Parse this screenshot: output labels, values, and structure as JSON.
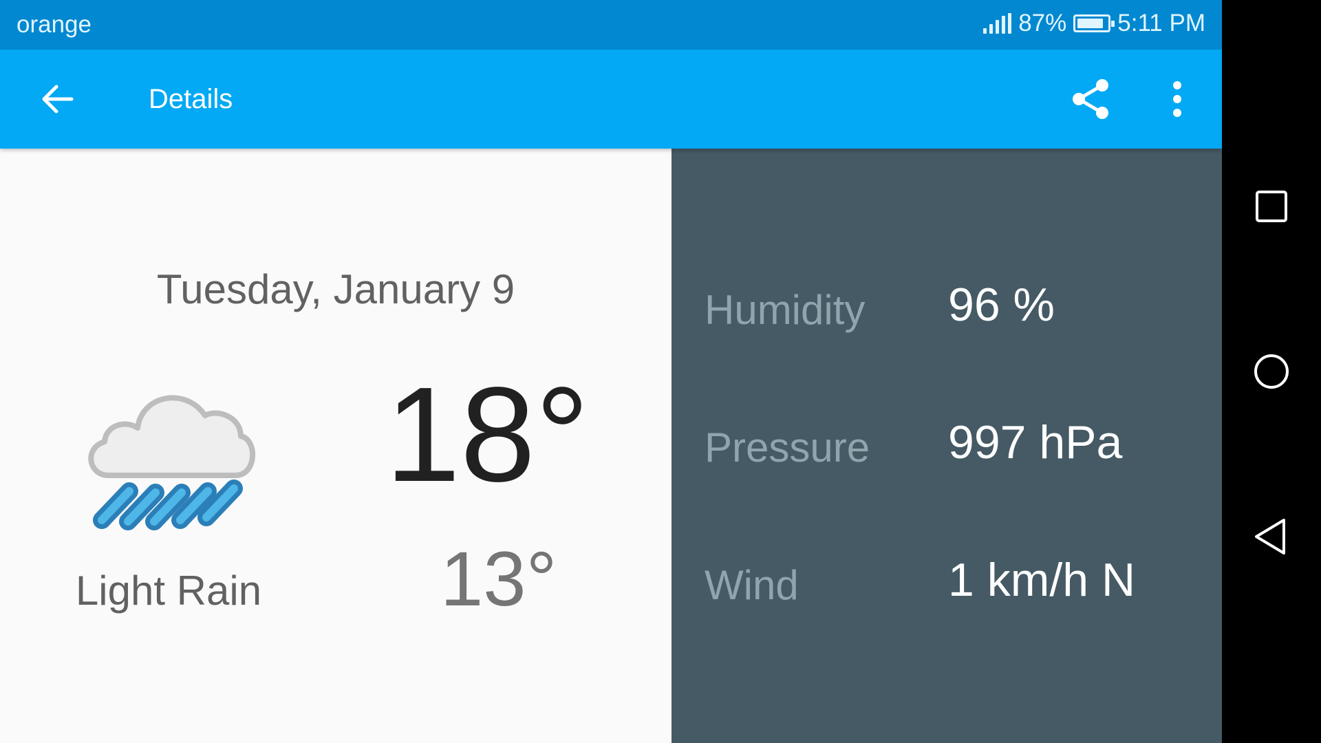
{
  "status_bar": {
    "carrier": "orange",
    "battery": "87%",
    "battery_level": 0.87,
    "time": "5:11 PM",
    "icons": [
      "signal-icon",
      "battery-icon"
    ]
  },
  "app_bar": {
    "title": "Details",
    "icons": [
      "back-arrow-icon",
      "share-icon",
      "more-vert-icon"
    ],
    "color": "#03a9f4"
  },
  "forecast": {
    "date": "Tuesday, January 9",
    "condition": "Light Rain",
    "icon": "light-rain-icon",
    "high": "18°",
    "low": "13°"
  },
  "details": {
    "humidity": {
      "label": "Humidity",
      "value": "96 %"
    },
    "pressure": {
      "label": "Pressure",
      "value": "997 hPa"
    },
    "wind": {
      "label": "Wind",
      "value": "1 km/h N"
    }
  },
  "nav_bar": {
    "icons": [
      "recents-square-icon",
      "home-circle-icon",
      "back-triangle-icon"
    ]
  },
  "colors": {
    "status_bar": "#0288d1",
    "detail_panel": "#455a64"
  }
}
